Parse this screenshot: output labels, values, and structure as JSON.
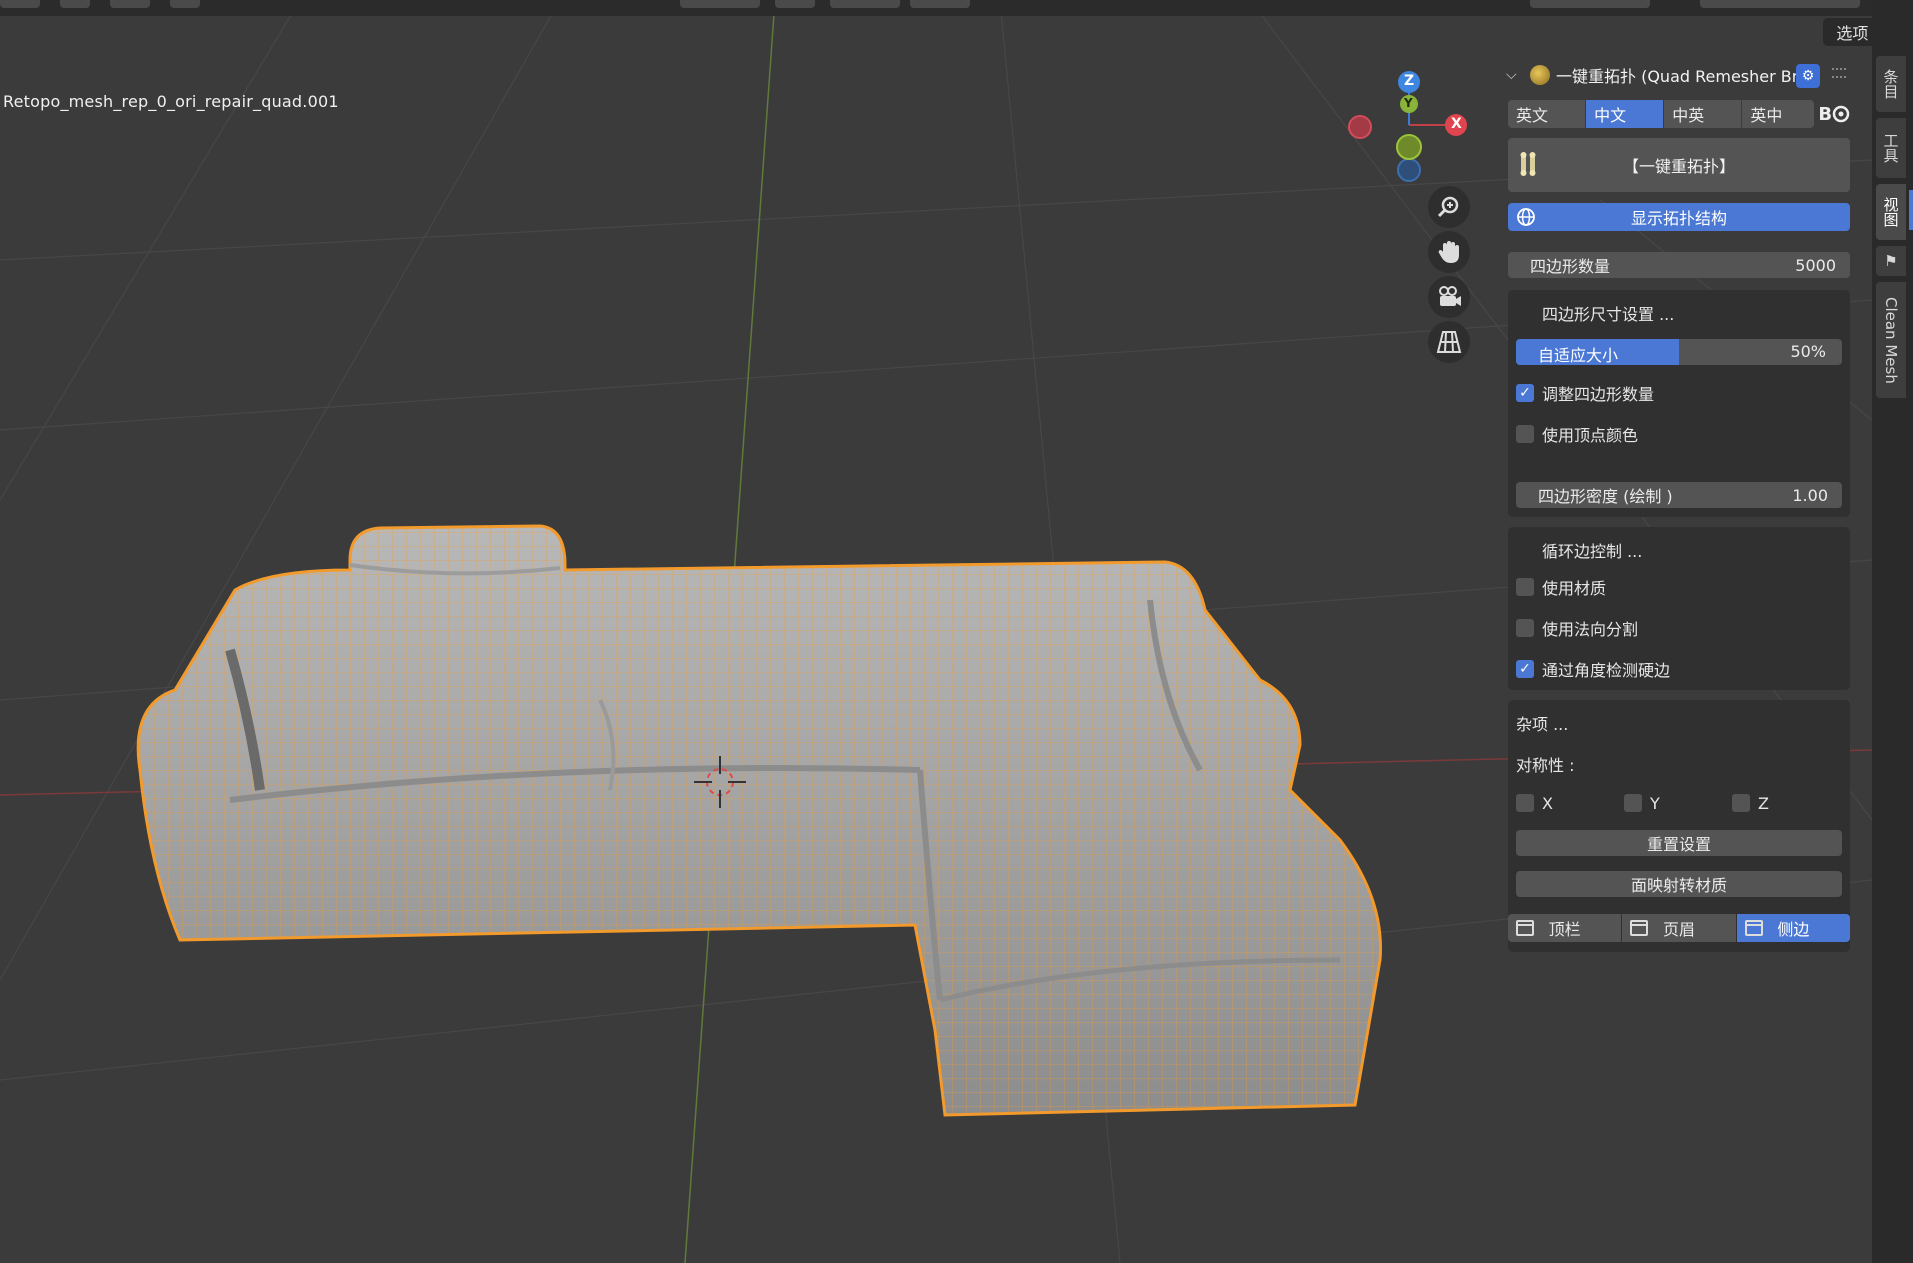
{
  "viewport": {
    "object_name": "Retopo_mesh_rep_0_ori_repair_quad.001",
    "options_label": "选项",
    "gizmo": {
      "x_label": "X",
      "y_label": "Y",
      "z_label": "Z"
    },
    "nav_buttons": [
      "zoom-icon",
      "hand-pan-icon",
      "camera-icon",
      "perspective-grid-icon"
    ]
  },
  "panel": {
    "title": "一键重拓扑 (Quad Remesher Bri",
    "title_suffix": ")",
    "language_tabs": [
      {
        "label": "英文",
        "active": false
      },
      {
        "label": "中文",
        "active": true
      },
      {
        "label": "中英",
        "active": false
      },
      {
        "label": "英中",
        "active": false
      }
    ],
    "logo_text": "B",
    "remesh_button": "【一键重拓扑】",
    "show_topology_button": "显示拓扑结构",
    "quad_count": {
      "label": "四边形数量",
      "value": "5000"
    },
    "size_section": {
      "title": "四边形尺寸设置 ...",
      "adaptive": {
        "label": "自适应大小",
        "value": "50%",
        "fraction": 0.5
      },
      "adjust_quad_count": {
        "label": "调整四边形数量",
        "checked": true
      },
      "use_vertex_color": {
        "label": "使用顶点颜色",
        "checked": false
      },
      "density": {
        "label": "四边形密度 (绘制 )",
        "value": "1.00"
      }
    },
    "edge_loops_section": {
      "title": "循环边控制 ...",
      "use_materials": {
        "label": "使用材质",
        "checked": false
      },
      "use_normals_split": {
        "label": "使用法向分割",
        "checked": false
      },
      "detect_hard_edges": {
        "label": "通过角度检测硬边",
        "checked": true
      }
    },
    "misc_section": {
      "title": "杂项 ...",
      "symmetry_label": "对称性 :",
      "sym_x": {
        "label": "X",
        "checked": false
      },
      "sym_y": {
        "label": "Y",
        "checked": false
      },
      "sym_z": {
        "label": "Z",
        "checked": false
      },
      "reset_button": "重置设置",
      "map_material_button": "面映射转材质"
    },
    "location_tabs": [
      {
        "label": "顶栏",
        "active": false
      },
      {
        "label": "页眉",
        "active": false
      },
      {
        "label": "侧边",
        "active": true
      }
    ]
  },
  "sidebar_tabs": [
    "条目",
    "工具",
    "视图",
    "Clean Mesh"
  ],
  "colors": {
    "accent": "#4a78d4",
    "mesh_wire": "#f39a2c",
    "mesh_fill": "#a9a9a9",
    "viewport_bg": "#3b3b3b"
  }
}
